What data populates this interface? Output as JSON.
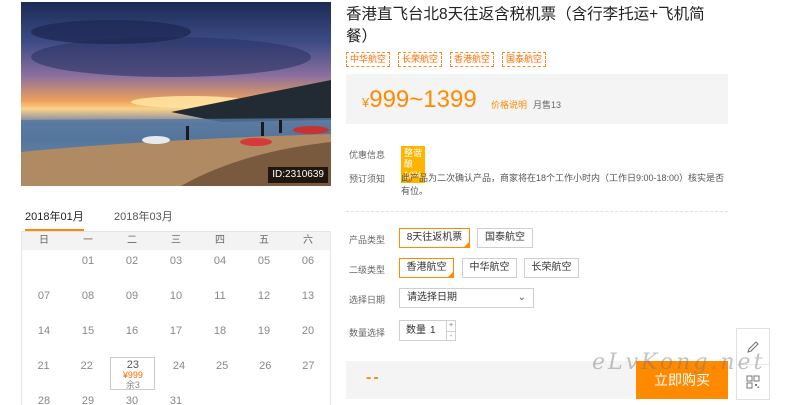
{
  "product": {
    "title": "香港直飞台北8天往返含税机票（含行李托运+飞机简餐）",
    "tags": [
      "中华航空",
      "长荣航空",
      "香港航空",
      "国泰航空"
    ],
    "image_id": "ID:2310639"
  },
  "price": {
    "currency": "¥",
    "range": "999~1399",
    "note": "价格说明",
    "sales": "月售13"
  },
  "info": {
    "promo_label": "优惠信息",
    "promo_badge": "整谐酿10%",
    "notice_label": "预订须知",
    "notice_text": "此产品为二次确认产品，商家将在18个工作小时内（工作日9:00-18:00）核实是否有位。"
  },
  "calendar": {
    "tabs": [
      "2018年01月",
      "2018年03月"
    ],
    "weekdays": [
      "日",
      "一",
      "二",
      "三",
      "四",
      "五",
      "六"
    ],
    "weeks": [
      [
        "",
        "01",
        "02",
        "03",
        "04",
        "05",
        "06"
      ],
      [
        "07",
        "08",
        "09",
        "10",
        "11",
        "12",
        "13"
      ],
      [
        "14",
        "15",
        "16",
        "17",
        "18",
        "19",
        "20"
      ],
      [
        "21",
        "22",
        "23",
        "24",
        "25",
        "26",
        "27"
      ],
      [
        "28",
        "29",
        "30",
        "31",
        "",
        "",
        ""
      ]
    ],
    "selected": {
      "day": "23",
      "price": "¥999",
      "remain": "余3"
    }
  },
  "options": {
    "product_type_label": "产品类型",
    "product_types": [
      "8天往返机票",
      "国泰航空"
    ],
    "sub_type_label": "二级类型",
    "sub_types": [
      "香港航空",
      "中华航空",
      "长荣航空"
    ],
    "date_label": "选择日期",
    "date_placeholder": "请选择日期",
    "qty_label": "数量选择",
    "qty_prefix": "数量",
    "qty_value": "1"
  },
  "buy": {
    "price_placeholder": "--",
    "button_label": "立即购买"
  },
  "watermark": "eLvKong.net",
  "colors": {
    "accent": "#ff8a00",
    "badge": "#ffb400"
  }
}
